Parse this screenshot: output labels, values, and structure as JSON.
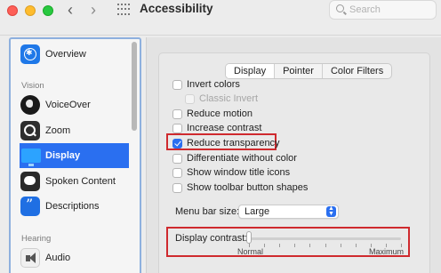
{
  "window": {
    "title": "Accessibility",
    "search_placeholder": "Search"
  },
  "sidebar": {
    "items": [
      {
        "label": "Overview",
        "icon": "overview-icon"
      },
      {
        "label": "VoiceOver",
        "icon": "voiceover-icon"
      },
      {
        "label": "Zoom",
        "icon": "zoom-icon"
      },
      {
        "label": "Display",
        "icon": "display-icon",
        "selected": true
      },
      {
        "label": "Spoken Content",
        "icon": "spoken-content-icon"
      },
      {
        "label": "Descriptions",
        "icon": "descriptions-icon"
      },
      {
        "label": "Audio",
        "icon": "audio-icon"
      }
    ],
    "sections": {
      "vision": "Vision",
      "hearing": "Hearing"
    }
  },
  "tabs": [
    {
      "label": "Display",
      "active": true
    },
    {
      "label": "Pointer",
      "active": false
    },
    {
      "label": "Color Filters",
      "active": false
    }
  ],
  "options": [
    {
      "label": "Invert colors",
      "checked": false,
      "disabled": false
    },
    {
      "label": "Classic Invert",
      "checked": false,
      "disabled": true
    },
    {
      "label": "Reduce motion",
      "checked": false,
      "disabled": false
    },
    {
      "label": "Increase contrast",
      "checked": false,
      "disabled": false
    },
    {
      "label": "Reduce transparency",
      "checked": true,
      "disabled": false
    },
    {
      "label": "Differentiate without color",
      "checked": false,
      "disabled": false
    },
    {
      "label": "Show window title icons",
      "checked": false,
      "disabled": false
    },
    {
      "label": "Show toolbar button shapes",
      "checked": false,
      "disabled": false
    }
  ],
  "menu_bar_size": {
    "label": "Menu bar size:",
    "value": "Large"
  },
  "display_contrast": {
    "label": "Display contrast:",
    "min_label": "Normal",
    "max_label": "Maximum",
    "value": 0
  },
  "colors": {
    "accent": "#2a6ff0",
    "highlight": "#cf2a2e"
  }
}
